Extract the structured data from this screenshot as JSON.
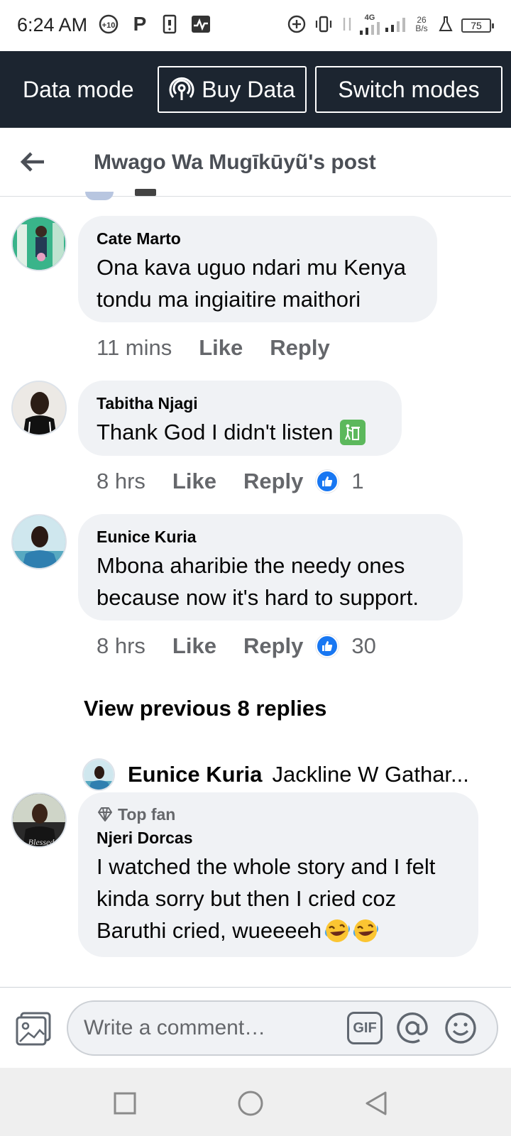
{
  "status_bar": {
    "time": "6:24 AM",
    "notif_badge": "+10",
    "parking_glyph": "P",
    "network": "4G",
    "speed_value": "26",
    "speed_unit": "B/s",
    "battery": "75",
    "icons": [
      "notification-count-icon",
      "parking-icon",
      "phone-icon",
      "activity-icon",
      "add-circle-icon",
      "vibrate-icon",
      "data-arrows-icon",
      "signal-icon",
      "signal-icon-2",
      "flask-icon",
      "battery-icon"
    ]
  },
  "data_bar": {
    "label": "Data mode",
    "buy_label": "Buy Data",
    "switch_label": "Switch modes",
    "background": "#1c2530"
  },
  "header": {
    "title": "Mwago Wa Mugīkūyũ's post"
  },
  "comments": [
    {
      "name": "Cate Marto",
      "text_lines": [
        "Ona kava uguo ndari mu Kenya",
        "tondu ma ingiaitire maithori"
      ],
      "time": "11 mins",
      "like": "Like",
      "reply": "Reply"
    },
    {
      "name": "Tabitha Njagi",
      "text": "Thank God I didn't listen",
      "time": "8 hrs",
      "like": "Like",
      "reply": "Reply",
      "reactions": "1"
    },
    {
      "name": "Eunice Kuria",
      "text_lines": [
        "Mbona aharibie the needy ones",
        "because now it's hard to support."
      ],
      "time": "8 hrs",
      "like": "Like",
      "reply": "Reply",
      "reactions": "30"
    }
  ],
  "view_previous": "View previous 8 replies",
  "reply_preview": {
    "name": "Eunice Kuria",
    "text": "Jackline W Gathar..."
  },
  "top_fan_comment": {
    "badge": "Top fan",
    "name": "Njeri Dorcas",
    "text_lines": [
      "I watched the whole story and I felt",
      "kinda sorry but then I cried coz",
      "Baruthi cried, wueeeeh"
    ]
  },
  "composer": {
    "placeholder": "Write a comment…",
    "gif_label": "GIF"
  },
  "colors": {
    "accent": "#1877f2",
    "bubble": "#f0f2f5",
    "meta_text": "#65676b"
  }
}
